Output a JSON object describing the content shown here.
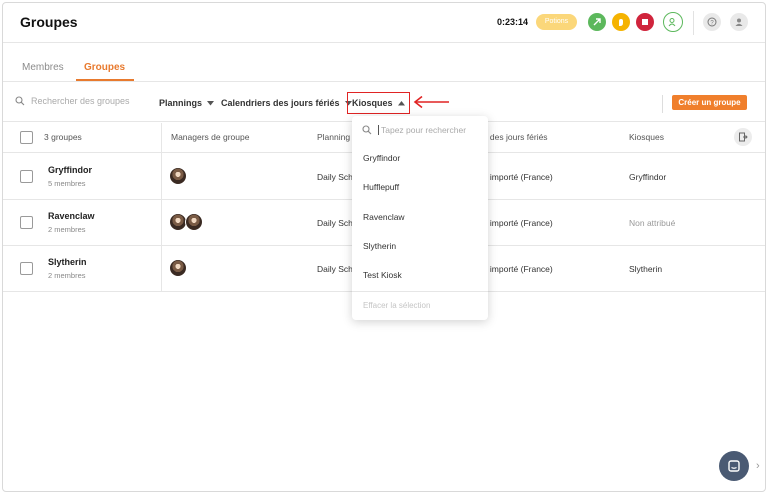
{
  "header": {
    "title": "Groupes",
    "timer": "0:23:14",
    "badge": "Potions",
    "colors": {
      "accent": "#f07f2c",
      "green": "#5cb85c",
      "yellow": "#f5b301",
      "red": "#d0243c"
    }
  },
  "tabs": [
    {
      "label": "Membres",
      "active": false
    },
    {
      "label": "Groupes",
      "active": true
    }
  ],
  "filters": {
    "search_placeholder": "Rechercher des groupes",
    "plannings": "Plannings",
    "calendriers": "Calendriers des jours fériés",
    "kiosques": "Kiosques",
    "create_button": "Créer un groupe"
  },
  "table": {
    "count_label": "3 groupes",
    "columns": [
      "Managers de groupe",
      "Planning",
      "er des jours fériés",
      "Kiosques"
    ],
    "rows": [
      {
        "name": "Gryffindor",
        "members": "5 membres",
        "planning": "Daily Sch",
        "calendar": "er importé (France)",
        "kiosk": "Gryffindor",
        "kiosk_muted": false
      },
      {
        "name": "Ravenclaw",
        "members": "2 membres",
        "planning": "Daily Sch",
        "calendar": "er importé (France)",
        "kiosk": "Non attribué",
        "kiosk_muted": true
      },
      {
        "name": "Slytherin",
        "members": "2 membres",
        "planning": "Daily Sch",
        "calendar": "er importé (France)",
        "kiosk": "Slytherin",
        "kiosk_muted": false
      }
    ]
  },
  "dropdown": {
    "search_placeholder": "Tapez pour rechercher",
    "options": [
      "Gryffindor",
      "Hufflepuff",
      "Ravenclaw",
      "Slytherin",
      "Test Kiosk"
    ],
    "clear_label": "Effacer la sélection"
  }
}
